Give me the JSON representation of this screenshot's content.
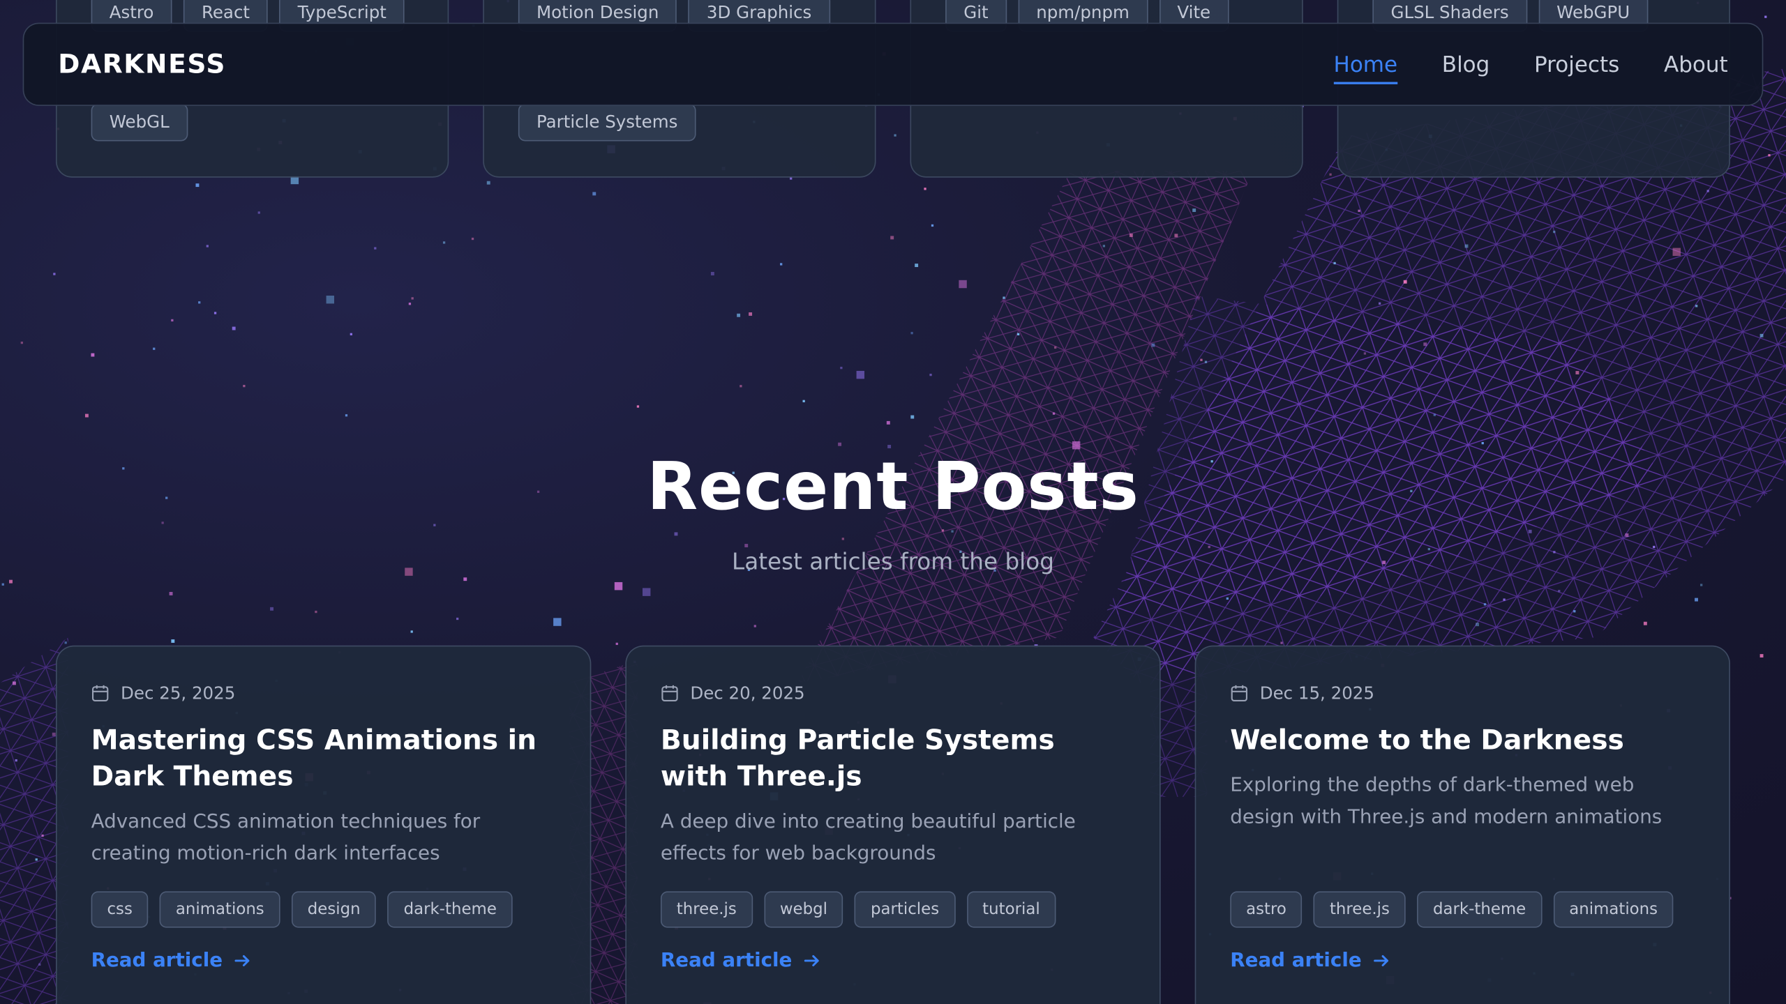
{
  "brand": "DARKNESS",
  "nav": {
    "items": [
      {
        "label": "Home",
        "active": true
      },
      {
        "label": "Blog",
        "active": false
      },
      {
        "label": "Projects",
        "active": false
      },
      {
        "label": "About",
        "active": false
      }
    ]
  },
  "skills": {
    "cards": [
      {
        "tags_top": [
          "Astro",
          "React",
          "TypeScript"
        ],
        "tags_bottom": [
          "WebGL"
        ]
      },
      {
        "tags_top": [
          "Motion Design",
          "3D Graphics"
        ],
        "tags_bottom": [
          "Particle Systems"
        ]
      },
      {
        "tags_top": [
          "Git",
          "npm/pnpm",
          "Vite"
        ],
        "tags_bottom": []
      },
      {
        "tags_top": [
          "GLSL Shaders",
          "WebGPU"
        ],
        "tags_bottom": []
      }
    ]
  },
  "section": {
    "title": "Recent Posts",
    "subtitle": "Latest articles from the blog"
  },
  "posts": [
    {
      "date": "Dec 25, 2025",
      "title": "Mastering CSS Animations in Dark Themes",
      "description": "Advanced CSS animation techniques for creating motion-rich dark interfaces",
      "tags": [
        "css",
        "animations",
        "design",
        "dark-theme"
      ],
      "link": "Read article"
    },
    {
      "date": "Dec 20, 2025",
      "title": "Building Particle Systems with Three.js",
      "description": "A deep dive into creating beautiful particle effects for web backgrounds",
      "tags": [
        "three.js",
        "webgl",
        "particles",
        "tutorial"
      ],
      "link": "Read article"
    },
    {
      "date": "Dec 15, 2025",
      "title": "Welcome to the Darkness",
      "description": "Exploring the depths of dark-themed web design with Three.js and modern animations",
      "tags": [
        "astro",
        "three.js",
        "dark-theme",
        "animations"
      ],
      "link": "Read article"
    }
  ],
  "colors": {
    "accent": "#3b82f6",
    "background": "#15142c",
    "card": "#1f293b",
    "wireframe_purple": "#8b3fd6",
    "wireframe_pink": "#c0388a"
  },
  "icons": {
    "post_date": "calendar-icon",
    "read_link": "arrow-right-icon"
  }
}
